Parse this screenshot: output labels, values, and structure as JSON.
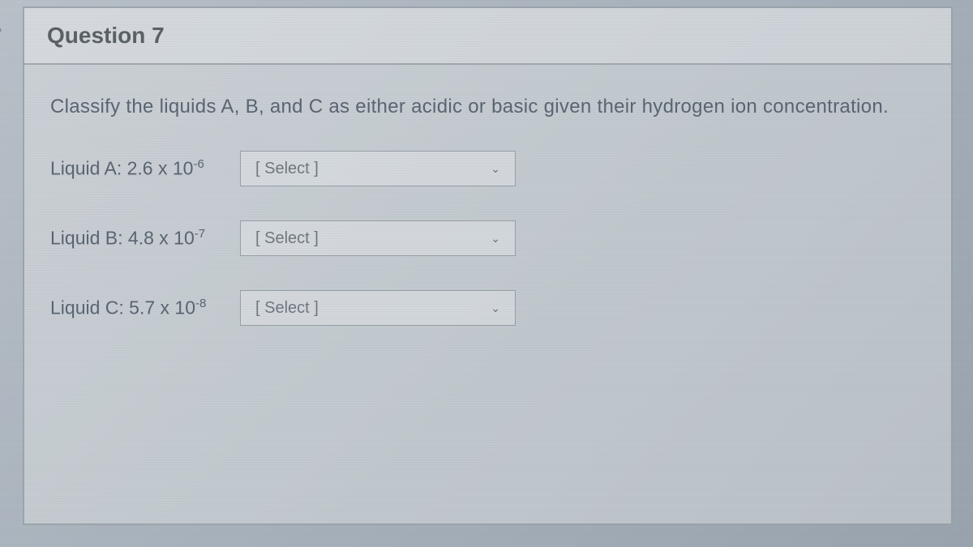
{
  "header": {
    "title": "Question 7"
  },
  "instruction": "Classify the liquids A, B, and C as either acidic or basic given their hydrogen ion concentration.",
  "liquids": [
    {
      "label_prefix": "Liquid A: 2.6 x 10",
      "label_exp": "-6",
      "placeholder": "[ Select ]"
    },
    {
      "label_prefix": "Liquid B: 4.8 x 10",
      "label_exp": "-7",
      "placeholder": "[ Select ]"
    },
    {
      "label_prefix": "Liquid C: 5.7 x 10",
      "label_exp": "-8",
      "placeholder": "[ Select ]"
    }
  ]
}
